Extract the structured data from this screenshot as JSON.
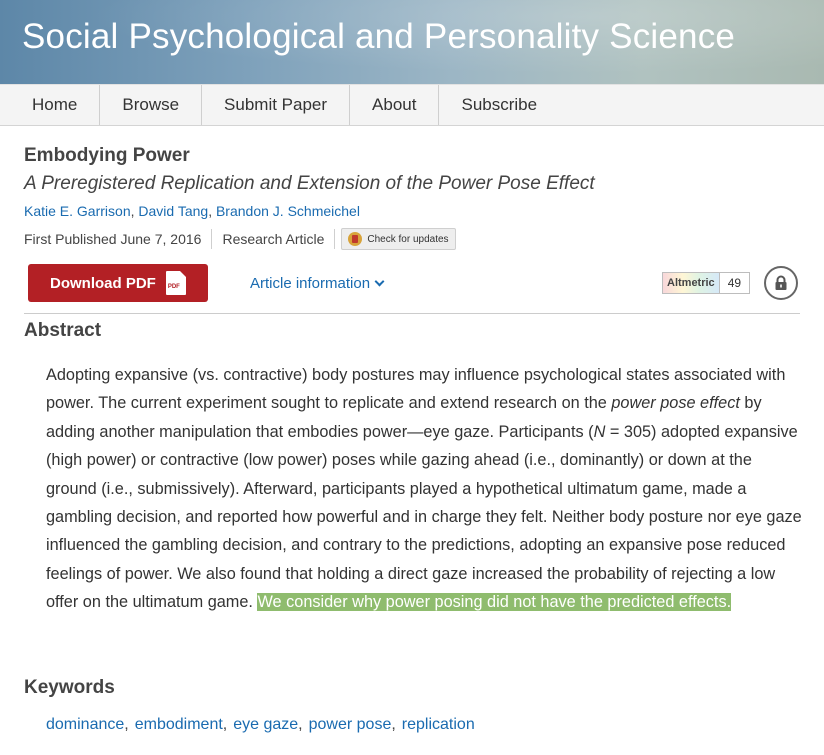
{
  "header": {
    "journal_title": "Social Psychological and Personality Science"
  },
  "nav": [
    {
      "label": "Home"
    },
    {
      "label": "Browse"
    },
    {
      "label": "Submit Paper"
    },
    {
      "label": "About"
    },
    {
      "label": "Subscribe"
    }
  ],
  "article": {
    "title": "Embodying Power",
    "subtitle": "A Preregistered Replication and Extension of the Power Pose Effect",
    "authors": [
      "Katie E. Garrison",
      "David Tang",
      "Brandon J. Schmeichel"
    ],
    "first_published": "First Published June 7, 2016",
    "type": "Research Article",
    "check_updates": "Check for updates"
  },
  "actions": {
    "download_pdf": "Download PDF",
    "pdf_icon_text": "PDF",
    "article_information": "Article information",
    "altmetric_label": "Altmetric",
    "altmetric_score": "49"
  },
  "abstract": {
    "heading": "Abstract",
    "text_1": "Adopting expansive (vs. contractive) body postures may influence psychological states associated with power. The current experiment sought to replicate and extend research on the ",
    "text_em": "power pose effect",
    "text_2": " by adding another manipulation that embodies power—eye gaze. Participants (",
    "text_n": "N",
    "text_3": " = 305) adopted expansive (high power) or contractive (low power) poses while gazing ahead (i.e., dominantly) or down at the ground (i.e., submissively). Afterward, participants played a hypothetical ultimatum game, made a gambling decision, and reported how powerful and in charge they felt. Neither body posture nor eye gaze influenced the gambling decision, and contrary to the predictions, adopting an expansive pose reduced feelings of power. We also found that holding a direct gaze increased the probability of rejecting a low offer on the ultimatum game. ",
    "highlighted": "We consider why power posing did not have the predicted effects."
  },
  "keywords": {
    "heading": "Keywords",
    "items": [
      "dominance",
      "embodiment",
      "eye gaze",
      "power pose",
      "replication"
    ],
    "separator": ","
  },
  "colors": {
    "pdf_button": "#b32025",
    "link": "#1a6bb0",
    "highlight": "#8fbc6e"
  },
  "icons": [
    "pdf-icon",
    "chevron-down-icon",
    "lock-icon",
    "check-updates-icon"
  ]
}
